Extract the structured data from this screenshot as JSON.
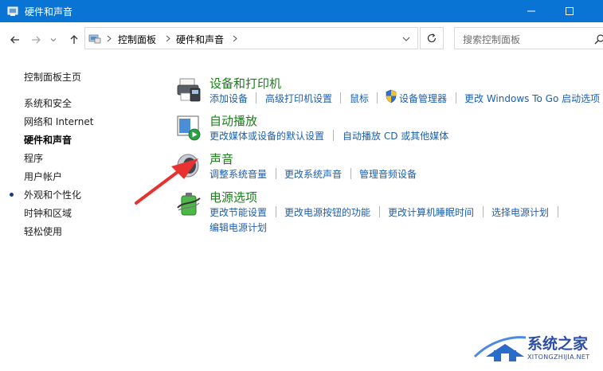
{
  "window": {
    "title": "硬件和声音",
    "controls": [
      "minimize-icon",
      "maximize-icon",
      "close-icon"
    ]
  },
  "nav": {
    "back_icon": "arrow-left-icon",
    "forward_icon": "arrow-right-icon",
    "dropdown_icon": "chevron-down-icon",
    "up_icon": "arrow-up-icon",
    "breadcrumb": [
      "控制面板",
      "硬件和声音"
    ],
    "refresh_icon": "refresh-icon",
    "search_placeholder": "搜索控制面板"
  },
  "sidebar": {
    "home": "控制面板主页",
    "items": [
      "系统和安全",
      "网络和 Internet",
      "硬件和声音",
      "程序",
      "用户帐户",
      "外观和个性化",
      "时钟和区域",
      "轻松使用"
    ],
    "active_index": 2
  },
  "categories": {
    "devices": {
      "title": "设备和打印机",
      "links": [
        "添加设备",
        "高级打印机设置",
        "鼠标",
        "设备管理器",
        "更改 Windows To Go 启动选项"
      ]
    },
    "autoplay": {
      "title": "自动播放",
      "links": [
        "更改媒体或设备的默认设置",
        "自动播放 CD 或其他媒体"
      ]
    },
    "sound": {
      "title": "声音",
      "links": [
        "调整系统音量",
        "更改系统声音",
        "管理音频设备"
      ]
    },
    "power": {
      "title": "电源选项",
      "links": [
        "更改节能设置",
        "更改电源按钮的功能",
        "更改计算机睡眠时间",
        "选择电源计划",
        "编辑电源计划"
      ]
    }
  },
  "watermark": {
    "name": "系统之家",
    "domain": "XITONGZHIJIA.NET"
  },
  "colors": {
    "titlebar": "#0a74d4",
    "category_title": "#1a7f1a",
    "link": "#1a5fb4",
    "arrow": "#e8322f"
  }
}
